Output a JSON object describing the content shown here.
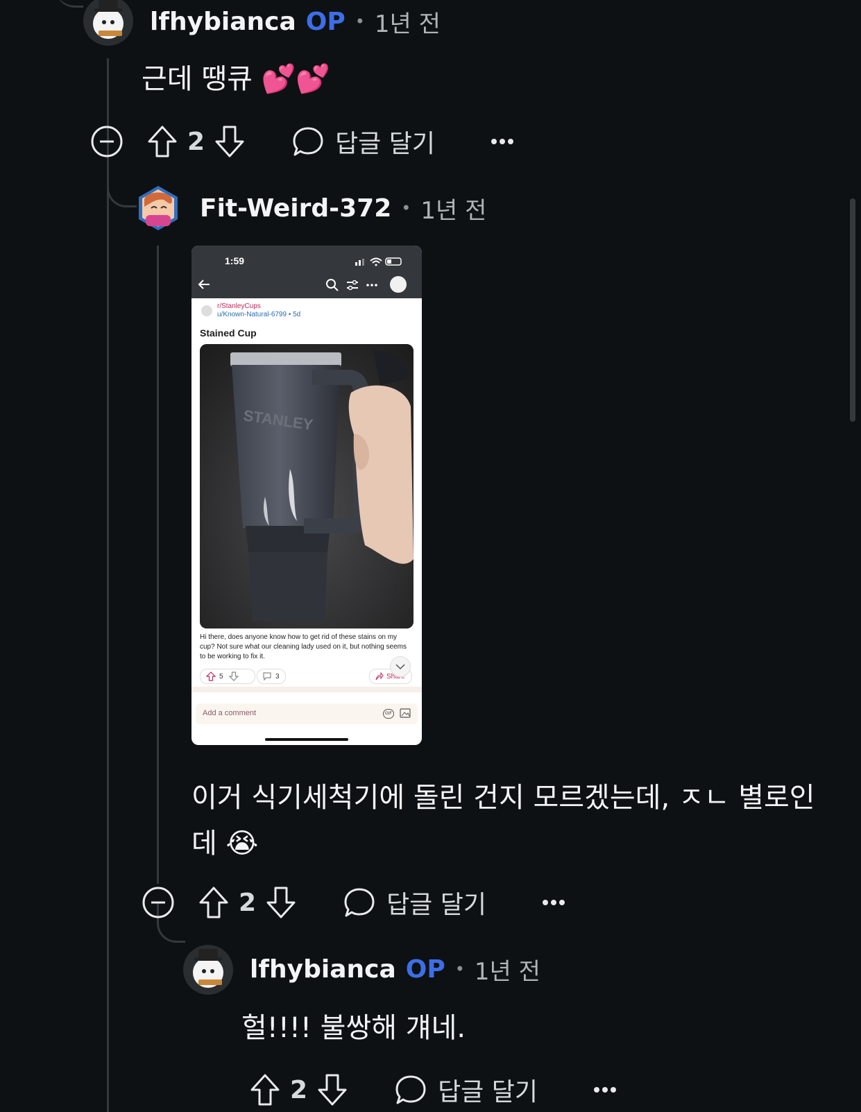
{
  "comments": [
    {
      "author": "lfhybianca",
      "op_badge": "OP",
      "separator": "•",
      "time": "1년 전",
      "body": "근데 땡큐 💕💕",
      "votes": "2",
      "reply_label": "답글 달기"
    },
    {
      "author": "Fit-Weird-372",
      "separator": "•",
      "time": "1년 전",
      "body_line1": "이거 식기세척기에 돌린 건지 모르겠는데, ㅈㄴ 별로인",
      "body_line2": "데 😭",
      "votes": "2",
      "reply_label": "답글 달기"
    },
    {
      "author": "lfhybianca",
      "op_badge": "OP",
      "separator": "•",
      "time": "1년 전",
      "body": "헐!!!! 불쌍해 걔네.",
      "votes": "2",
      "reply_label": "답글 달기"
    }
  ],
  "screenshot": {
    "clock": "1:59",
    "subreddit": "r/StanleyCups",
    "user": "u/Known-Natural-6799 • 5d",
    "title": "Stained Cup",
    "cup_brand": "STANLEY",
    "caption": "Hi there, does anyone know how to get rid of these stains on my cup? Not sure what our cleaning lady used on it, but nothing seems to be working to fix it.",
    "upvotes": "5",
    "comments": "3",
    "share": "Share",
    "comment_placeholder": "Add a comment",
    "gif_label": "GIF"
  },
  "colors": {
    "background": "#0e1113",
    "op_badge": "#3d6ee8",
    "thread_line": "#33393d"
  }
}
